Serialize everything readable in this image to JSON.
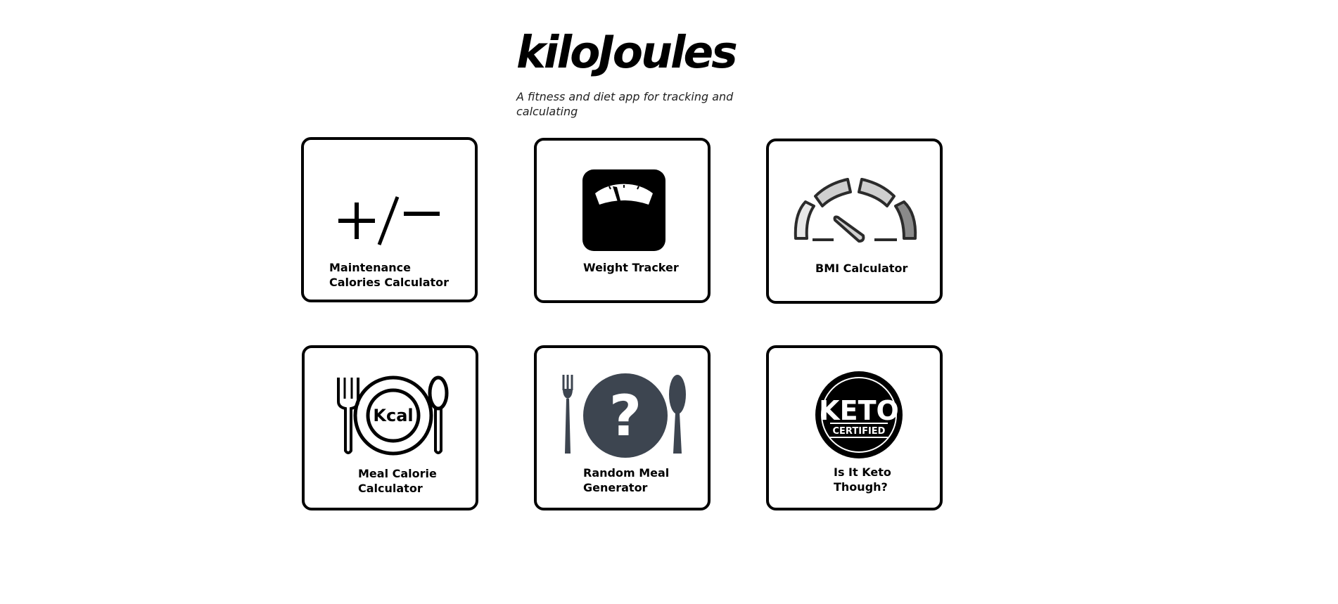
{
  "header": {
    "title": "kiloJoules",
    "subtitle": "A fitness and diet app for tracking and calculating"
  },
  "cards": [
    {
      "label": "Maintenance Calories Calculator",
      "icon": "plus-minus-icon"
    },
    {
      "label": "Weight Tracker",
      "icon": "weighing-scale-icon"
    },
    {
      "label": "BMI Calculator",
      "icon": "gauge-icon"
    },
    {
      "label": "Meal Calorie Calculator",
      "icon": "plate-kcal-icon",
      "icon_text": "Kcal"
    },
    {
      "label": "Random Meal Generator",
      "icon": "question-plate-icon",
      "icon_text": "?"
    },
    {
      "label": "Is It Keto Though?",
      "icon": "keto-certified-icon",
      "icon_text": [
        "KETO",
        "CERTIFIED"
      ]
    }
  ]
}
